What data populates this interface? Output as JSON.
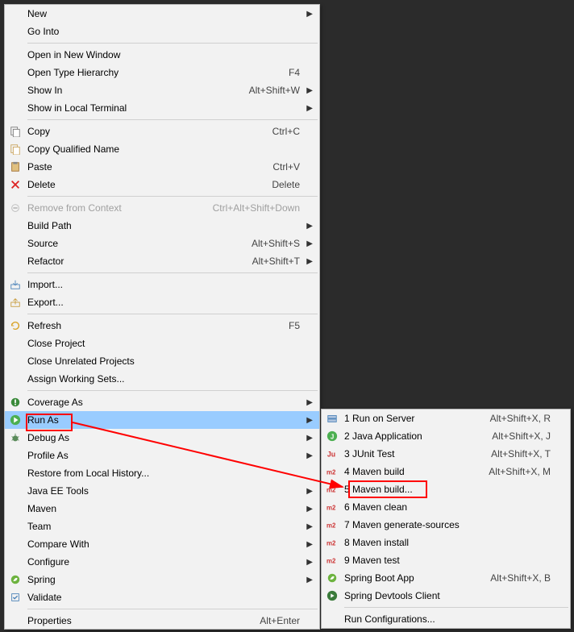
{
  "main_menu": [
    {
      "type": "item",
      "label": "New",
      "shortcut": "",
      "submenu": true,
      "icon": "",
      "name": "menu-new"
    },
    {
      "type": "item",
      "label": "Go Into",
      "shortcut": "",
      "submenu": false,
      "icon": "",
      "name": "menu-go-into"
    },
    {
      "type": "sep"
    },
    {
      "type": "item",
      "label": "Open in New Window",
      "shortcut": "",
      "submenu": false,
      "icon": "",
      "name": "menu-open-new-window"
    },
    {
      "type": "item",
      "label": "Open Type Hierarchy",
      "shortcut": "F4",
      "submenu": false,
      "icon": "",
      "name": "menu-open-type-hierarchy"
    },
    {
      "type": "item",
      "label": "Show In",
      "shortcut": "Alt+Shift+W",
      "submenu": true,
      "icon": "",
      "name": "menu-show-in"
    },
    {
      "type": "item",
      "label": "Show in Local Terminal",
      "shortcut": "",
      "submenu": true,
      "icon": "",
      "name": "menu-show-local-terminal"
    },
    {
      "type": "sep"
    },
    {
      "type": "item",
      "label": "Copy",
      "shortcut": "Ctrl+C",
      "submenu": false,
      "icon": "copy",
      "name": "menu-copy"
    },
    {
      "type": "item",
      "label": "Copy Qualified Name",
      "shortcut": "",
      "submenu": false,
      "icon": "copy-q",
      "name": "menu-copy-qualified"
    },
    {
      "type": "item",
      "label": "Paste",
      "shortcut": "Ctrl+V",
      "submenu": false,
      "icon": "paste",
      "name": "menu-paste"
    },
    {
      "type": "item",
      "label": "Delete",
      "shortcut": "Delete",
      "submenu": false,
      "icon": "delete",
      "name": "menu-delete"
    },
    {
      "type": "sep"
    },
    {
      "type": "item",
      "label": "Remove from Context",
      "shortcut": "Ctrl+Alt+Shift+Down",
      "submenu": false,
      "icon": "remove-ctx",
      "name": "menu-remove-context",
      "disabled": true
    },
    {
      "type": "item",
      "label": "Build Path",
      "shortcut": "",
      "submenu": true,
      "icon": "",
      "name": "menu-build-path"
    },
    {
      "type": "item",
      "label": "Source",
      "shortcut": "Alt+Shift+S",
      "submenu": true,
      "icon": "",
      "name": "menu-source"
    },
    {
      "type": "item",
      "label": "Refactor",
      "shortcut": "Alt+Shift+T",
      "submenu": true,
      "icon": "",
      "name": "menu-refactor"
    },
    {
      "type": "sep"
    },
    {
      "type": "item",
      "label": "Import...",
      "shortcut": "",
      "submenu": false,
      "icon": "import",
      "name": "menu-import"
    },
    {
      "type": "item",
      "label": "Export...",
      "shortcut": "",
      "submenu": false,
      "icon": "export",
      "name": "menu-export"
    },
    {
      "type": "sep"
    },
    {
      "type": "item",
      "label": "Refresh",
      "shortcut": "F5",
      "submenu": false,
      "icon": "refresh",
      "name": "menu-refresh"
    },
    {
      "type": "item",
      "label": "Close Project",
      "shortcut": "",
      "submenu": false,
      "icon": "",
      "name": "menu-close-project"
    },
    {
      "type": "item",
      "label": "Close Unrelated Projects",
      "shortcut": "",
      "submenu": false,
      "icon": "",
      "name": "menu-close-unrelated"
    },
    {
      "type": "item",
      "label": "Assign Working Sets...",
      "shortcut": "",
      "submenu": false,
      "icon": "",
      "name": "menu-assign-working-sets"
    },
    {
      "type": "sep"
    },
    {
      "type": "item",
      "label": "Coverage As",
      "shortcut": "",
      "submenu": true,
      "icon": "coverage",
      "name": "menu-coverage-as"
    },
    {
      "type": "item",
      "label": "Run As",
      "shortcut": "",
      "submenu": true,
      "icon": "run",
      "name": "menu-run-as",
      "highlight": true
    },
    {
      "type": "item",
      "label": "Debug As",
      "shortcut": "",
      "submenu": true,
      "icon": "debug",
      "name": "menu-debug-as"
    },
    {
      "type": "item",
      "label": "Profile As",
      "shortcut": "",
      "submenu": true,
      "icon": "",
      "name": "menu-profile-as"
    },
    {
      "type": "item",
      "label": "Restore from Local History...",
      "shortcut": "",
      "submenu": false,
      "icon": "",
      "name": "menu-restore-history"
    },
    {
      "type": "item",
      "label": "Java EE Tools",
      "shortcut": "",
      "submenu": true,
      "icon": "",
      "name": "menu-javaee-tools"
    },
    {
      "type": "item",
      "label": "Maven",
      "shortcut": "",
      "submenu": true,
      "icon": "",
      "name": "menu-maven"
    },
    {
      "type": "item",
      "label": "Team",
      "shortcut": "",
      "submenu": true,
      "icon": "",
      "name": "menu-team"
    },
    {
      "type": "item",
      "label": "Compare With",
      "shortcut": "",
      "submenu": true,
      "icon": "",
      "name": "menu-compare-with"
    },
    {
      "type": "item",
      "label": "Configure",
      "shortcut": "",
      "submenu": true,
      "icon": "",
      "name": "menu-configure"
    },
    {
      "type": "item",
      "label": "Spring",
      "shortcut": "",
      "submenu": true,
      "icon": "spring",
      "name": "menu-spring"
    },
    {
      "type": "item",
      "label": "Validate",
      "shortcut": "",
      "submenu": false,
      "icon": "validate",
      "name": "menu-validate"
    },
    {
      "type": "sep"
    },
    {
      "type": "item",
      "label": "Properties",
      "shortcut": "Alt+Enter",
      "submenu": false,
      "icon": "",
      "name": "menu-properties"
    }
  ],
  "sub_menu": [
    {
      "type": "item",
      "label": "1 Run on Server",
      "shortcut": "Alt+Shift+X, R",
      "icon": "server",
      "name": "submenu-run-on-server"
    },
    {
      "type": "item",
      "label": "2 Java Application",
      "shortcut": "Alt+Shift+X, J",
      "icon": "java",
      "name": "submenu-java-app"
    },
    {
      "type": "item",
      "label": "3 JUnit Test",
      "shortcut": "Alt+Shift+X, T",
      "icon": "junit",
      "name": "submenu-junit"
    },
    {
      "type": "item",
      "label": "4 Maven build",
      "shortcut": "Alt+Shift+X, M",
      "icon": "m2",
      "name": "submenu-maven-build"
    },
    {
      "type": "item",
      "label": "5 Maven build...",
      "shortcut": "",
      "icon": "m2",
      "name": "submenu-maven-build-config"
    },
    {
      "type": "item",
      "label": "6 Maven clean",
      "shortcut": "",
      "icon": "m2",
      "name": "submenu-maven-clean"
    },
    {
      "type": "item",
      "label": "7 Maven generate-sources",
      "shortcut": "",
      "icon": "m2",
      "name": "submenu-maven-gen"
    },
    {
      "type": "item",
      "label": "8 Maven install",
      "shortcut": "",
      "icon": "m2",
      "name": "submenu-maven-install"
    },
    {
      "type": "item",
      "label": "9 Maven test",
      "shortcut": "",
      "icon": "m2",
      "name": "submenu-maven-test"
    },
    {
      "type": "item",
      "label": "Spring Boot App",
      "shortcut": "Alt+Shift+X, B",
      "icon": "spring",
      "name": "submenu-spring-boot"
    },
    {
      "type": "item",
      "label": "Spring Devtools Client",
      "shortcut": "",
      "icon": "spring-dev",
      "name": "submenu-spring-devtools"
    },
    {
      "type": "sep"
    },
    {
      "type": "item",
      "label": "Run Configurations...",
      "shortcut": "",
      "icon": "",
      "name": "submenu-run-config"
    }
  ]
}
